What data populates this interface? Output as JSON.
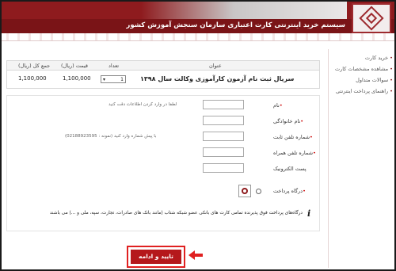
{
  "header": {
    "title": "سیستم خرید اینترنتی کارت اعتباری سازمان سنجش آموزش کشور"
  },
  "sidebar": {
    "items": [
      {
        "label": "خرید کارت"
      },
      {
        "label": "مشاهده مشخصات کارت"
      },
      {
        "label": "سوالات متداول"
      },
      {
        "label": "راهنمای پرداخت اینترنتی"
      }
    ]
  },
  "item_table": {
    "headers": {
      "title": "عنوان",
      "quantity": "تعداد",
      "price": "قیمت (ریال)",
      "total": "جمع کل (ریال)"
    },
    "row": {
      "title": "سریال ثبت نام آزمون کارآموزی وکالت سال ۱۳۹۸",
      "quantity": "1",
      "price": "1,100,000",
      "total": "1,100,000"
    }
  },
  "form": {
    "first_name_label": "نام",
    "first_name_hint": "لطفا در وارد کردن اطلاعات دقت کنید",
    "last_name_label": "نام خانوادگی",
    "phone_label": "شماره تلفن ثابت",
    "phone_hint": "با پیش شماره وارد کنید (نمونه : 02188923595)",
    "mobile_label": "شماره تلفن همراه",
    "email_label": "پست الکترونیک",
    "gateway_label": "درگاه پرداخت",
    "note": "درگاه‌های پرداخت فوق پذیرنده تمامی کارت های بانکی عضو شبکه شتاب (مانند بانک های صادرات، تجارت، سپه، ملی و ...) می باشند"
  },
  "submit": {
    "label": "تایید و ادامه"
  },
  "colors": {
    "brand": "#8e1b1e",
    "button": "#b5181c",
    "highlight": "#e02020"
  }
}
